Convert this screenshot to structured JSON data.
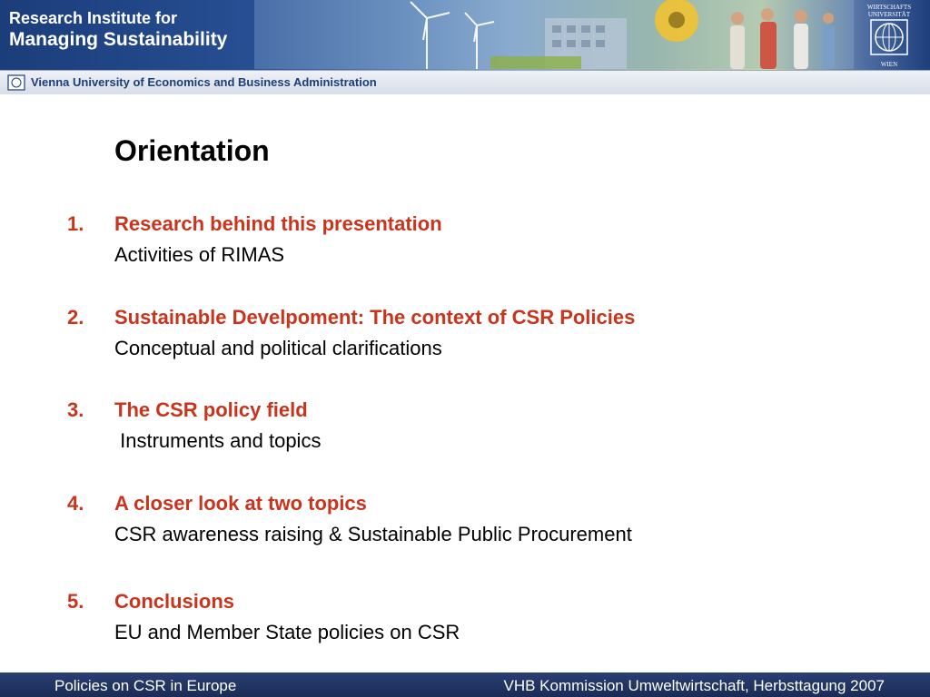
{
  "header": {
    "institute_line1": "Research Institute for",
    "institute_line2": "Managing Sustainability",
    "university": "Vienna University of Economics and Business Administration",
    "logo_top": "WIRTSCHAFTS UNIVERSITÄT",
    "logo_bottom": "WIEN"
  },
  "slide": {
    "title": "Orientation",
    "items": [
      {
        "number": "1.",
        "heading": "Research behind this presentation",
        "detail": "Activities of RIMAS"
      },
      {
        "number": "2.",
        "heading": "Sustainable Develpoment: The context of CSR Policies",
        "detail": "Conceptual and political clarifications"
      },
      {
        "number": "3.",
        "heading": "The CSR policy field",
        "detail": " Instruments and topics"
      },
      {
        "number": "4.",
        "heading": "A closer look at two topics",
        "detail": "CSR awareness raising & Sustainable Public Procurement"
      },
      {
        "number": "5.",
        "heading": "Conclusions",
        "detail": "EU and Member State policies on CSR"
      }
    ]
  },
  "footer": {
    "left": "Policies on CSR in Europe",
    "right": "VHB Kommission Umweltwirtschaft, Herbsttagung 2007"
  },
  "colors": {
    "accent_red": "#c8341c",
    "brand_blue": "#1b3d7a"
  }
}
